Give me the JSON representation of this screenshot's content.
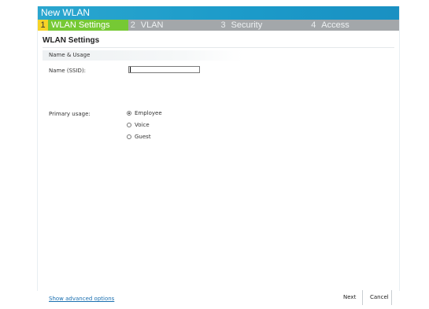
{
  "window": {
    "title": "New WLAN"
  },
  "wizard": {
    "steps": [
      {
        "num": "1",
        "label": "WLAN Settings"
      },
      {
        "num": "2",
        "label": "VLAN"
      },
      {
        "num": "3",
        "label": "Security"
      },
      {
        "num": "4",
        "label": "Access"
      }
    ],
    "active_step": 0
  },
  "section": {
    "title": "WLAN Settings"
  },
  "group": {
    "header": "Name & Usage"
  },
  "form": {
    "ssid_label": "Name (SSID):",
    "ssid_value": "",
    "primary_usage_label": "Primary usage:",
    "usage_options": [
      {
        "label": "Employee",
        "checked": true
      },
      {
        "label": "Voice",
        "checked": false
      },
      {
        "label": "Guest",
        "checked": false
      }
    ]
  },
  "footer": {
    "advanced_link": "Show advanced options",
    "next_label": "Next",
    "cancel_label": "Cancel"
  },
  "colors": {
    "titlebar": "#1b9ac9",
    "active_step": "#76c934",
    "active_step_num": "#f6d327",
    "inactive_step": "#a3a7aa",
    "link": "#1a6fb0"
  }
}
